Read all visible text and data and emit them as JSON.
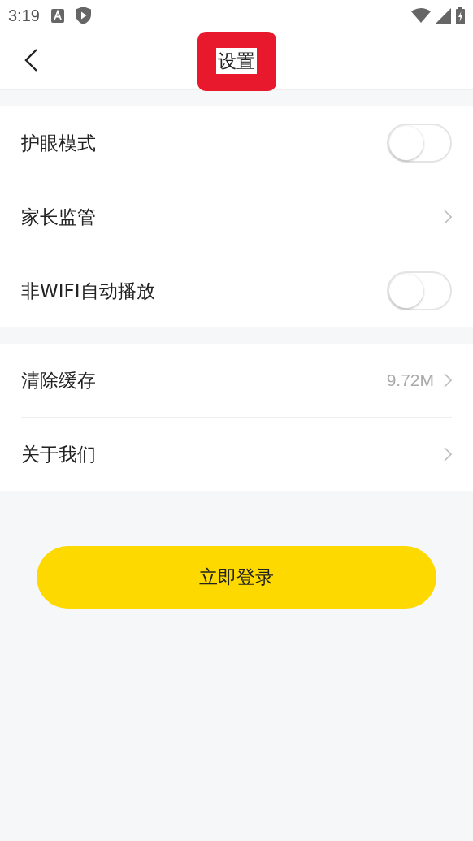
{
  "status_bar": {
    "time": "3:19"
  },
  "header": {
    "title": "设置"
  },
  "groups": [
    {
      "rows": [
        {
          "kind": "toggle",
          "label": "护眼模式",
          "on": false
        },
        {
          "kind": "link",
          "label": "家长监管"
        },
        {
          "kind": "toggle",
          "label": "非WIFI自动播放",
          "on": false
        }
      ]
    },
    {
      "rows": [
        {
          "kind": "link",
          "label": "清除缓存",
          "value": "9.72M"
        },
        {
          "kind": "link",
          "label": "关于我们"
        }
      ]
    }
  ],
  "login_button": "立即登录"
}
